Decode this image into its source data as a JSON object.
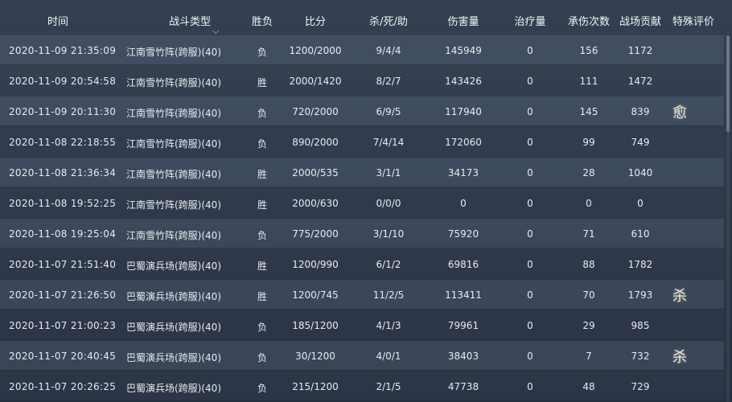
{
  "columns": {
    "time": "时间",
    "type": "战斗类型",
    "result": "胜负",
    "score": "比分",
    "kda": "杀/死/助",
    "damage": "伤害量",
    "healing": "治疗量",
    "damage_taken": "承伤次数",
    "contribution": "战场贡献",
    "special": "特殊评价"
  },
  "filter_icon": "chevron-down-icon",
  "rows": [
    {
      "time": "2020-11-09 21:35:09",
      "type": "江南雪竹阵(跨服)(40)",
      "result": "负",
      "score": "1200/2000",
      "kda": "9/4/4",
      "damage": "145949",
      "healing": "0",
      "taken": "156",
      "contribution": "1172",
      "badge": ""
    },
    {
      "time": "2020-11-09 20:54:58",
      "type": "江南雪竹阵(跨服)(40)",
      "result": "胜",
      "score": "2000/1420",
      "kda": "8/2/7",
      "damage": "143426",
      "healing": "0",
      "taken": "111",
      "contribution": "1472",
      "badge": ""
    },
    {
      "time": "2020-11-09 20:11:30",
      "type": "江南雪竹阵(跨服)(40)",
      "result": "负",
      "score": "720/2000",
      "kda": "6/9/5",
      "damage": "117940",
      "healing": "0",
      "taken": "145",
      "contribution": "839",
      "badge": "愈"
    },
    {
      "time": "2020-11-08 22:18:55",
      "type": "江南雪竹阵(跨服)(40)",
      "result": "负",
      "score": "890/2000",
      "kda": "7/4/14",
      "damage": "172060",
      "healing": "0",
      "taken": "99",
      "contribution": "749",
      "badge": ""
    },
    {
      "time": "2020-11-08 21:36:34",
      "type": "江南雪竹阵(跨服)(40)",
      "result": "胜",
      "score": "2000/535",
      "kda": "3/1/1",
      "damage": "34173",
      "healing": "0",
      "taken": "28",
      "contribution": "1040",
      "badge": ""
    },
    {
      "time": "2020-11-08 19:52:25",
      "type": "江南雪竹阵(跨服)(40)",
      "result": "胜",
      "score": "2000/630",
      "kda": "0/0/0",
      "damage": "0",
      "healing": "0",
      "taken": "0",
      "contribution": "0",
      "badge": ""
    },
    {
      "time": "2020-11-08 19:25:04",
      "type": "江南雪竹阵(跨服)(40)",
      "result": "负",
      "score": "775/2000",
      "kda": "3/1/10",
      "damage": "75920",
      "healing": "0",
      "taken": "71",
      "contribution": "610",
      "badge": ""
    },
    {
      "time": "2020-11-07 21:51:40",
      "type": "巴蜀演兵场(跨服)(40)",
      "result": "胜",
      "score": "1200/990",
      "kda": "6/1/2",
      "damage": "69816",
      "healing": "0",
      "taken": "88",
      "contribution": "1782",
      "badge": ""
    },
    {
      "time": "2020-11-07 21:26:50",
      "type": "巴蜀演兵场(跨服)(40)",
      "result": "胜",
      "score": "1200/745",
      "kda": "11/2/5",
      "damage": "113411",
      "healing": "0",
      "taken": "70",
      "contribution": "1793",
      "badge": "杀"
    },
    {
      "time": "2020-11-07 21:00:23",
      "type": "巴蜀演兵场(跨服)(40)",
      "result": "负",
      "score": "185/1200",
      "kda": "4/1/3",
      "damage": "79961",
      "healing": "0",
      "taken": "29",
      "contribution": "985",
      "badge": ""
    },
    {
      "time": "2020-11-07 20:40:45",
      "type": "巴蜀演兵场(跨服)(40)",
      "result": "负",
      "score": "30/1200",
      "kda": "4/0/1",
      "damage": "38403",
      "healing": "0",
      "taken": "7",
      "contribution": "732",
      "badge": "杀"
    },
    {
      "time": "2020-11-07 20:26:25",
      "type": "巴蜀演兵场(跨服)(40)",
      "result": "负",
      "score": "215/1200",
      "kda": "2/1/5",
      "damage": "47738",
      "healing": "0",
      "taken": "48",
      "contribution": "729",
      "badge": ""
    }
  ]
}
